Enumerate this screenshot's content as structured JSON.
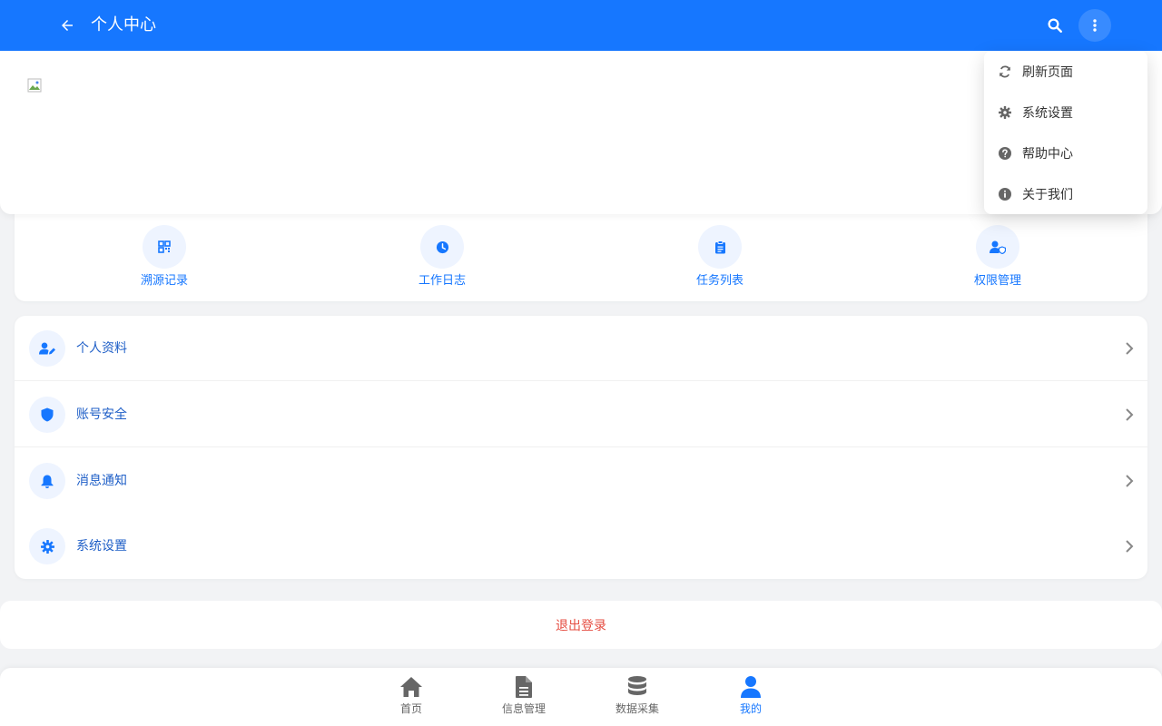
{
  "colors": {
    "accent": "#1677ff",
    "danger": "#e54d42"
  },
  "header": {
    "title": "个人中心"
  },
  "quick_actions": [
    {
      "label": "溯源记录",
      "icon": "qrcode-icon"
    },
    {
      "label": "工作日志",
      "icon": "clock-icon"
    },
    {
      "label": "任务列表",
      "icon": "clipboard-icon"
    },
    {
      "label": "权限管理",
      "icon": "user-shield-icon"
    }
  ],
  "menu": [
    {
      "label": "个人资料",
      "icon": "user-edit-icon"
    },
    {
      "label": "账号安全",
      "icon": "shield-icon"
    },
    {
      "label": "消息通知",
      "icon": "bell-icon"
    },
    {
      "label": "系统设置",
      "icon": "gear-icon"
    }
  ],
  "logout_label": "退出登录",
  "bottom_nav": [
    {
      "label": "首页",
      "icon": "home-icon"
    },
    {
      "label": "信息管理",
      "icon": "document-icon"
    },
    {
      "label": "数据采集",
      "icon": "database-icon"
    },
    {
      "label": "我的",
      "icon": "user-icon",
      "active": true
    }
  ],
  "dropdown": [
    {
      "label": "刷新页面",
      "icon": "refresh-icon"
    },
    {
      "label": "系统设置",
      "icon": "gear-icon"
    },
    {
      "label": "帮助中心",
      "icon": "question-circle-icon"
    },
    {
      "label": "关于我们",
      "icon": "info-circle-icon"
    }
  ]
}
